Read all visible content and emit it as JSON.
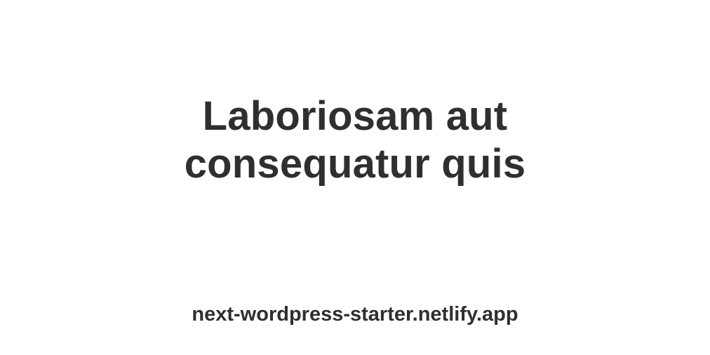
{
  "og_card": {
    "title_lines": [
      "Laboriosam aut",
      "consequatur quis"
    ],
    "site_domain": "next-wordpress-starter.netlify.app"
  },
  "colors": {
    "background": "#ffffff",
    "text": "#2f2f2f"
  }
}
